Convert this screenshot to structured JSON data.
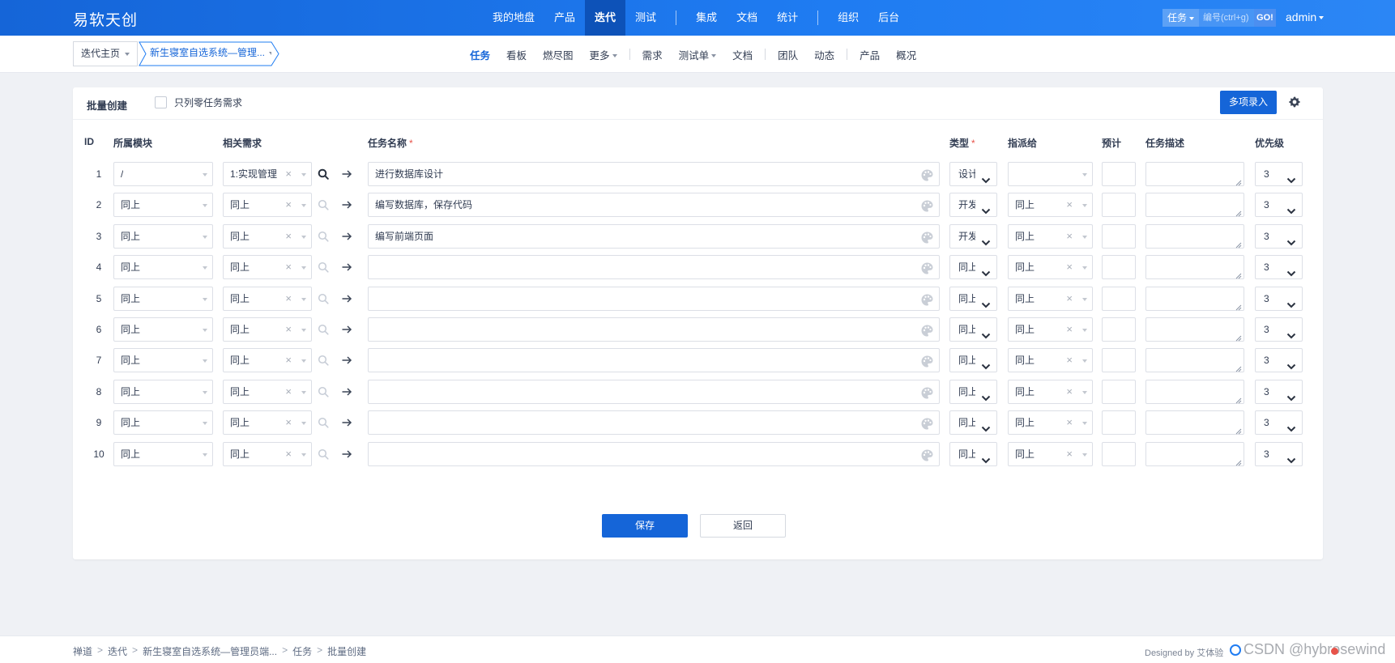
{
  "header": {
    "brand": "易软天创",
    "nav": [
      {
        "label": "我的地盘",
        "active": false
      },
      {
        "label": "产品",
        "active": false
      },
      {
        "label": "迭代",
        "active": true
      },
      {
        "label": "测试",
        "active": false
      },
      {
        "label": "集成",
        "active": false
      },
      {
        "label": "文档",
        "active": false
      },
      {
        "label": "统计",
        "active": false
      },
      {
        "label": "组织",
        "active": false
      },
      {
        "label": "后台",
        "active": false
      }
    ],
    "search": {
      "type": "任务",
      "placeholder": "编号(ctrl+g)",
      "go": "GO!"
    },
    "user": "admin"
  },
  "subnav": {
    "crumb_home": "迭代主页",
    "crumb_execution": "新生寝室自选系统—管理...",
    "items": [
      {
        "label": "任务",
        "active": true
      },
      {
        "label": "看板",
        "active": false
      },
      {
        "label": "燃尽图",
        "active": false
      },
      {
        "label": "更多",
        "active": false
      },
      {
        "label": "需求",
        "active": false
      },
      {
        "label": "测试单",
        "active": false
      },
      {
        "label": "文档",
        "active": false
      },
      {
        "label": "团队",
        "active": false
      },
      {
        "label": "动态",
        "active": false
      },
      {
        "label": "产品",
        "active": false
      },
      {
        "label": "概况",
        "active": false
      }
    ]
  },
  "panel": {
    "title": "批量创建",
    "only_zero_label": "只列零任务需求",
    "multi_button": "多项录入",
    "columns": {
      "id": "ID",
      "module": "所属模块",
      "story": "相关需求",
      "name": "任务名称",
      "type": "类型",
      "assign": "指派给",
      "estimate": "预计",
      "desc": "任务描述",
      "pri": "优先级"
    },
    "rows": [
      {
        "id": "1",
        "module": "/",
        "story": "1:实现管理",
        "name": "进行数据库设计",
        "type": "设计",
        "assign": "",
        "pri": "3"
      },
      {
        "id": "2",
        "module": "同上",
        "story": "同上",
        "name": "编写数据库，保存代码",
        "type": "开发",
        "assign": "同上",
        "pri": "3"
      },
      {
        "id": "3",
        "module": "同上",
        "story": "同上",
        "name": "编写前端页面",
        "type": "开发",
        "assign": "同上",
        "pri": "3"
      },
      {
        "id": "4",
        "module": "同上",
        "story": "同上",
        "name": "",
        "type": "同上",
        "assign": "同上",
        "pri": "3"
      },
      {
        "id": "5",
        "module": "同上",
        "story": "同上",
        "name": "",
        "type": "同上",
        "assign": "同上",
        "pri": "3"
      },
      {
        "id": "6",
        "module": "同上",
        "story": "同上",
        "name": "",
        "type": "同上",
        "assign": "同上",
        "pri": "3"
      },
      {
        "id": "7",
        "module": "同上",
        "story": "同上",
        "name": "",
        "type": "同上",
        "assign": "同上",
        "pri": "3"
      },
      {
        "id": "8",
        "module": "同上",
        "story": "同上",
        "name": "",
        "type": "同上",
        "assign": "同上",
        "pri": "3"
      },
      {
        "id": "9",
        "module": "同上",
        "story": "同上",
        "name": "",
        "type": "同上",
        "assign": "同上",
        "pri": "3"
      },
      {
        "id": "10",
        "module": "同上",
        "story": "同上",
        "name": "",
        "type": "同上",
        "assign": "同上",
        "pri": "3"
      }
    ],
    "save_label": "保存",
    "back_label": "返回"
  },
  "footer": {
    "crumbs": [
      "禅道",
      "迭代",
      "新生寝室自选系统—管理员端...",
      "任务",
      "批量创建"
    ],
    "designed_by": "Designed by 艾体验",
    "watermark": "CSDN @hybrosewind"
  },
  "colors": {
    "primary": "#1565d8",
    "required": "#e7534a",
    "bg": "#eff1f5"
  }
}
